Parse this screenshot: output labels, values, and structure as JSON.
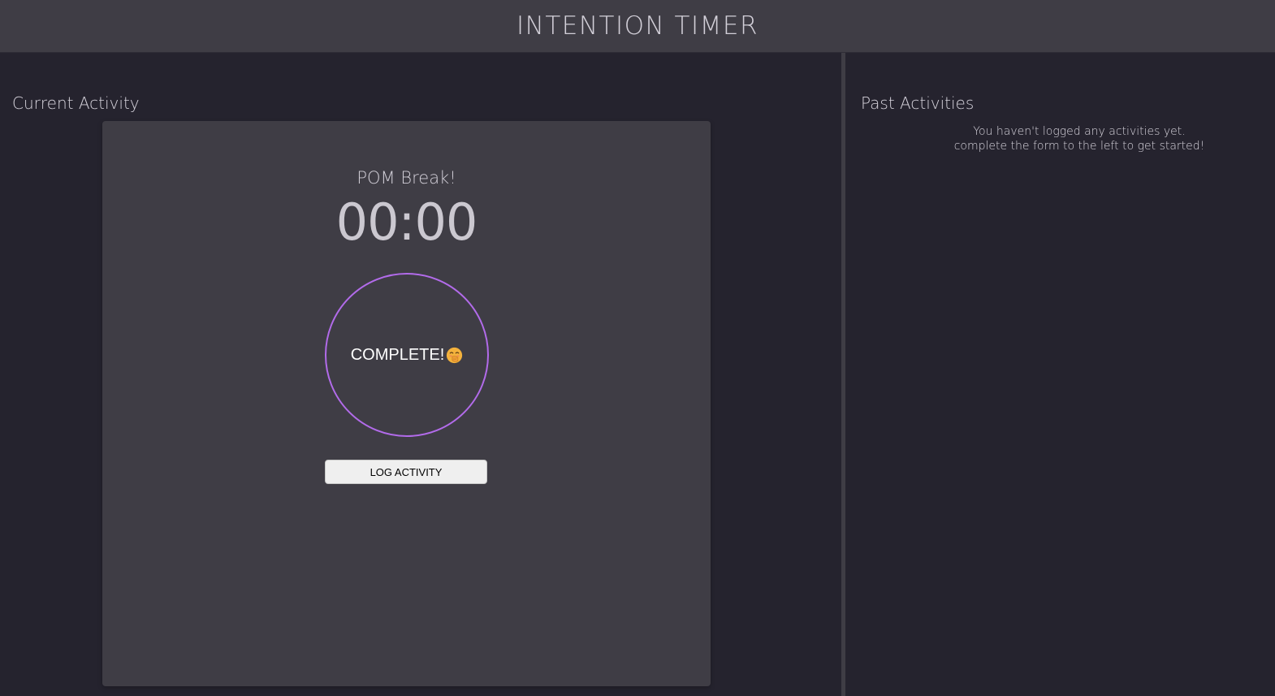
{
  "header": {
    "title": "INTENTION TIMER"
  },
  "current_activity": {
    "heading": "Current Activity",
    "activity_name": "POM Break!",
    "countdown": "00:00",
    "complete_label": "COMPLETE!",
    "complete_emoji": "face-with-hand-over-mouth-icon",
    "accent_color": "#b26bea",
    "log_button_label": "LOG ACTIVITY"
  },
  "past_activities": {
    "heading": "Past Activities",
    "empty_line_1": "You haven't logged any activities yet.",
    "empty_line_2": "complete the form to the left to get started!"
  }
}
